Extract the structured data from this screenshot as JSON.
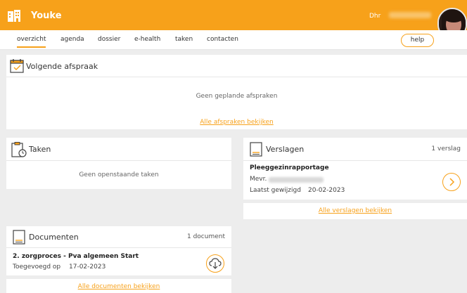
{
  "app": {
    "name": "Youke",
    "user_prefix": "Dhr"
  },
  "tabs": [
    {
      "label": "overzicht",
      "active": true
    },
    {
      "label": "agenda"
    },
    {
      "label": "dossier"
    },
    {
      "label": "e-health"
    },
    {
      "label": "taken"
    },
    {
      "label": "contacten"
    }
  ],
  "help_label": "help",
  "afspraak": {
    "title": "Volgende afspraak",
    "empty": "Geen geplande afspraken",
    "link": "Alle afspraken bekijken"
  },
  "taken": {
    "title": "Taken",
    "empty": "Geen openstaande taken"
  },
  "verslagen": {
    "title": "Verslagen",
    "count": "1 verslag",
    "item": {
      "title": "Pleeggezinrapportage",
      "prefix": "Mevr.",
      "modified_label": "Laatst gewijzigd",
      "modified_date": "20-02-2023"
    },
    "link": "Alle verslagen bekijken"
  },
  "documenten": {
    "title": "Documenten",
    "count": "1 document",
    "item": {
      "title": "2. zorgproces - Pva algemeen Start",
      "added_label": "Toegevoegd op",
      "added_date": "17-02-2023"
    },
    "link": "Alle documenten bekijken"
  },
  "colors": {
    "accent": "#f7a11a",
    "background": "#ededed"
  },
  "icons": [
    "building-icon",
    "calendar-icon",
    "clipboard-clock-icon",
    "report-icon",
    "document-icon",
    "chevron-right-icon",
    "download-cloud-icon"
  ]
}
